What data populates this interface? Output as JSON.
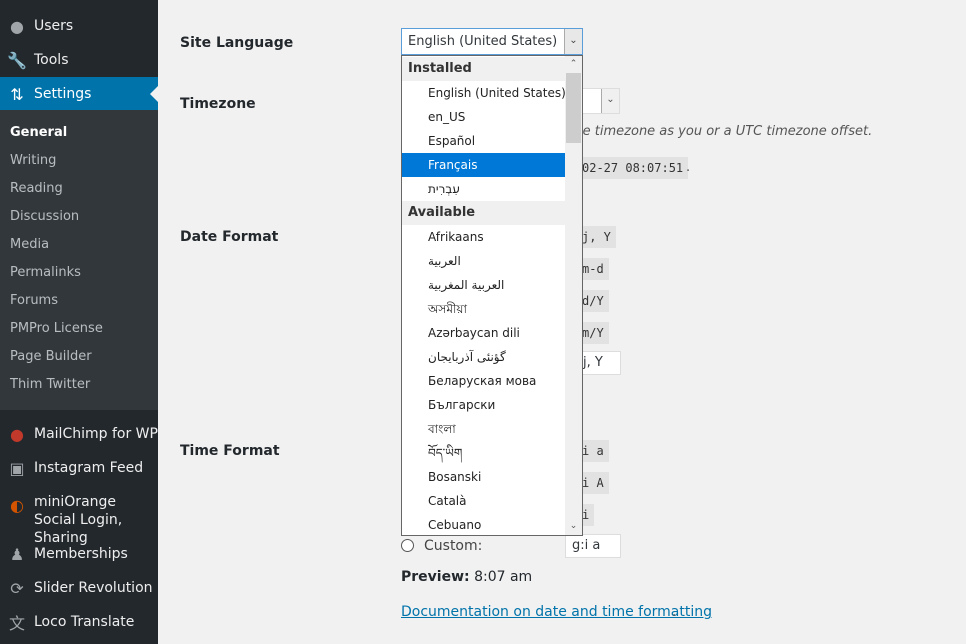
{
  "sidebar": {
    "top_items": [
      {
        "label": "Users",
        "icon": "user-icon"
      },
      {
        "label": "Tools",
        "icon": "wrench-icon"
      },
      {
        "label": "Settings",
        "icon": "settings-icon",
        "active": true
      }
    ],
    "submenu": [
      "General",
      "Writing",
      "Reading",
      "Discussion",
      "Media",
      "Permalinks",
      "Forums",
      "PMPro License",
      "Page Builder",
      "Thim Twitter"
    ],
    "plugin_items": [
      {
        "label": "MailChimp for WP",
        "icon": "mailchimp-icon"
      },
      {
        "label": "Instagram Feed",
        "icon": "camera-icon"
      },
      {
        "label": "miniOrange Social Login, Sharing",
        "icon": "miniorange-icon"
      },
      {
        "label": "Memberships",
        "icon": "groups-icon"
      },
      {
        "label": "Slider Revolution",
        "icon": "refresh-icon"
      },
      {
        "label": "Loco Translate",
        "icon": "translate-icon"
      }
    ]
  },
  "main": {
    "labels": {
      "site_language": "Site Language",
      "timezone": "Timezone",
      "date_format": "Date Format",
      "time_format": "Time Format"
    },
    "site_language_value": "English (United States)",
    "timezone_hint": "me timezone as you or a UTC timezone offset.",
    "utc_time": "02-27 08:07:51",
    "utc_period": ".",
    "date_formats": [
      "j, Y",
      "m-d",
      "d/Y",
      "m/Y"
    ],
    "date_custom_value": "j, Y",
    "time_formats": [
      "i a",
      "i A",
      "i"
    ],
    "time_custom_label": "Custom:",
    "time_custom_value": "g:i a",
    "preview_label": "Preview:",
    "preview_value": "8:07 am",
    "doc_link": "Documentation on date and time formatting",
    "doc_period": "."
  },
  "dropdown": {
    "groups": [
      {
        "label": "Installed",
        "options": [
          "English (United States)",
          "en_US",
          "Español",
          "Français",
          "עִבְרִית"
        ]
      },
      {
        "label": "Available",
        "options": [
          "Afrikaans",
          "العربية",
          "العربية المغربية",
          "অসমীয়া",
          "Azərbaycan dili",
          "گؤنئی آذربایجان",
          "Беларуская мова",
          "Български",
          "বাংলা",
          "བོད་ཡིག",
          "Bosanski",
          "Català",
          "Cebuano"
        ]
      }
    ],
    "selected": "Français"
  },
  "colors": {
    "sidebar_bg": "#23282d",
    "active_bg": "#0073aa",
    "highlight": "#0078d7",
    "link": "#0073aa"
  }
}
